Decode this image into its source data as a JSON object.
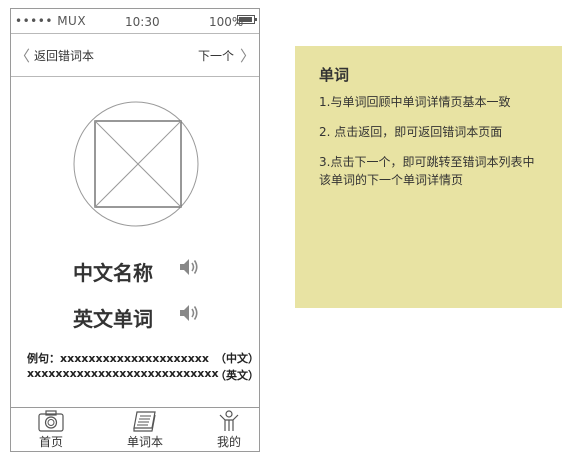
{
  "statusbar": {
    "carrier": "••••• MUX",
    "time": "10:30",
    "battery": "100%"
  },
  "nav": {
    "back_label": "返回错词本",
    "next_label": "下一个"
  },
  "word": {
    "chinese": "中文名称",
    "english": "英文单词"
  },
  "example": {
    "line1": "例句：xxxxxxxxxxxxxxxxxxxxx",
    "tag1": "（中文）",
    "line2": "xxxxxxxxxxxxxxxxxxxxxxxxxxx",
    "tag2": "（英文）"
  },
  "tabs": [
    {
      "label": "首页",
      "icon": "camera-icon"
    },
    {
      "label": "单词本",
      "icon": "book-icon"
    },
    {
      "label": "我的",
      "icon": "person-icon"
    }
  ],
  "note": {
    "title": "单词",
    "items": [
      "1.与单词回顾中单词详情页基本一致",
      "2. 点击返回，即可返回错词本页面",
      "3.点击下一个，即可跳转至错词本列表中该单词的下一个单词详情页"
    ]
  },
  "colors": {
    "note_bg": "#e8e3a3",
    "border": "#9a9a9a"
  }
}
